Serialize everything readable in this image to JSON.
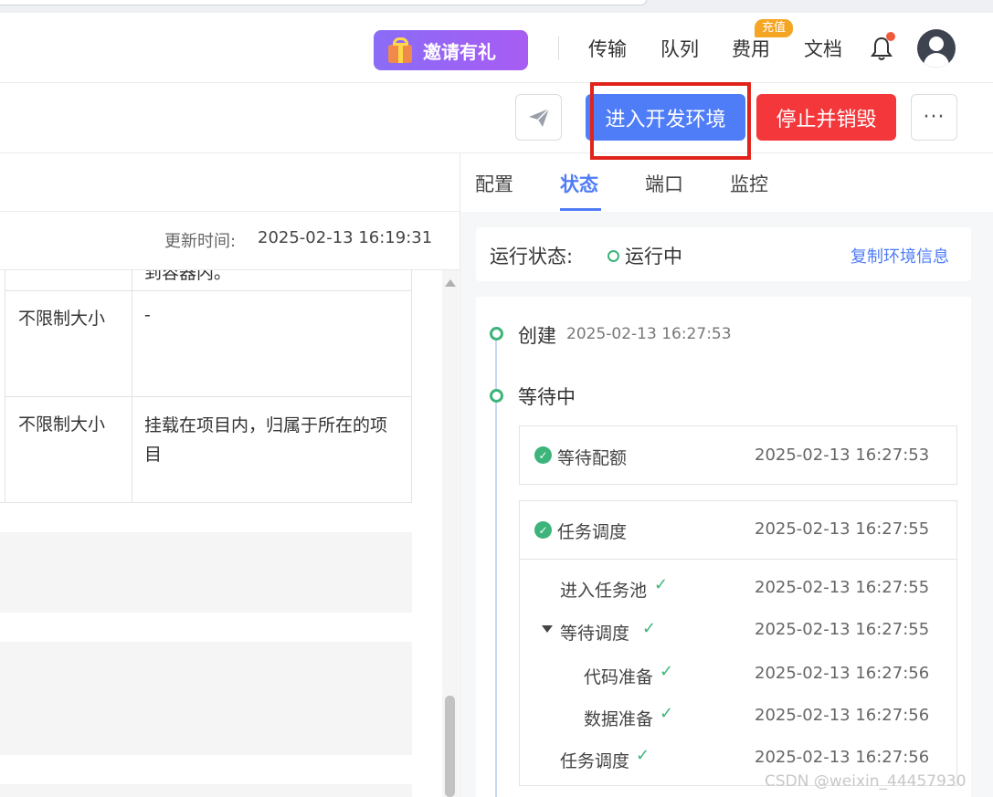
{
  "header": {
    "invite_label": "邀请有礼",
    "nav": [
      "传输",
      "队列",
      "费用",
      "文档"
    ],
    "badge": "充值"
  },
  "toolbar": {
    "dev_env_label": "进入开发环境",
    "stop_destroy_label": "停止并销毁",
    "more_label": "···"
  },
  "left": {
    "update_label": "更新时间:",
    "update_value": "2025-02-13 16:19:31",
    "table_partial": "到容器内。",
    "rows": [
      {
        "size": "不限制大小",
        "desc": "-"
      },
      {
        "size": "不限制大小",
        "desc": "挂载在项目内，归属于所在的项目"
      }
    ]
  },
  "tabs": [
    "配置",
    "状态",
    "端口",
    "监控"
  ],
  "active_tab": "状态",
  "status": {
    "label": "运行状态:",
    "value": "运行中",
    "copy_link": "复制环境信息"
  },
  "timeline": {
    "created_label": "创建",
    "created_time": "2025-02-13 16:27:53",
    "waiting_label": "等待中",
    "quota": {
      "label": "等待配额",
      "time": "2025-02-13 16:27:53"
    },
    "schedule": {
      "label": "任务调度",
      "time": "2025-02-13 16:27:55"
    },
    "steps": [
      {
        "label": "进入任务池",
        "time": "2025-02-13 16:27:55"
      },
      {
        "label": "等待调度",
        "time": "2025-02-13 16:27:55"
      },
      {
        "label": "代码准备",
        "time": "2025-02-13 16:27:56"
      },
      {
        "label": "数据准备",
        "time": "2025-02-13 16:27:56"
      },
      {
        "label": "任务调度",
        "time": "2025-02-13 16:27:56"
      }
    ]
  },
  "watermark": "CSDN @weixin_44457930",
  "colors": {
    "accent": "#4f7cf7",
    "danger": "#f3373a",
    "success": "#3cb47a",
    "highlight_box": "#e0241b"
  }
}
